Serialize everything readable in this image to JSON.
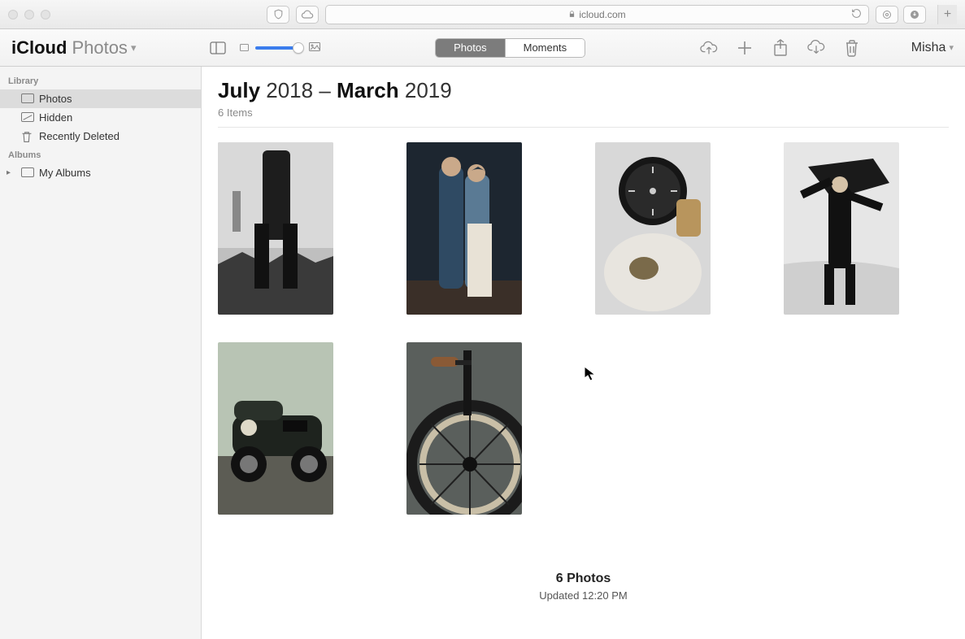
{
  "browser": {
    "url_host": "icloud.com"
  },
  "app": {
    "brand_bold": "iCloud",
    "brand_light": "Photos"
  },
  "segmented": {
    "photos": "Photos",
    "moments": "Moments"
  },
  "user": {
    "name": "Misha"
  },
  "sidebar": {
    "sections": [
      {
        "header": "Library",
        "items": [
          {
            "label": "Photos",
            "icon": "photos-rect",
            "selected": true
          },
          {
            "label": "Hidden",
            "icon": "hidden-rect"
          },
          {
            "label": "Recently Deleted",
            "icon": "trash"
          }
        ]
      },
      {
        "header": "Albums",
        "items": [
          {
            "label": "My Albums",
            "icon": "album-rect",
            "disclosure": true
          }
        ]
      }
    ]
  },
  "header": {
    "start_month": "July",
    "start_year": "2018",
    "sep": "–",
    "end_month": "March",
    "end_year": "2019",
    "item_count_label": "6 Items"
  },
  "photos": [
    {
      "name": "person-rooftop-bw"
    },
    {
      "name": "couple-portrait"
    },
    {
      "name": "motorcycle-gauge-bw"
    },
    {
      "name": "man-umbrella-bw"
    },
    {
      "name": "vintage-car"
    },
    {
      "name": "bicycle-wheel"
    }
  ],
  "footer": {
    "count_label": "6 Photos",
    "updated_label": "Updated 12:20 PM"
  }
}
